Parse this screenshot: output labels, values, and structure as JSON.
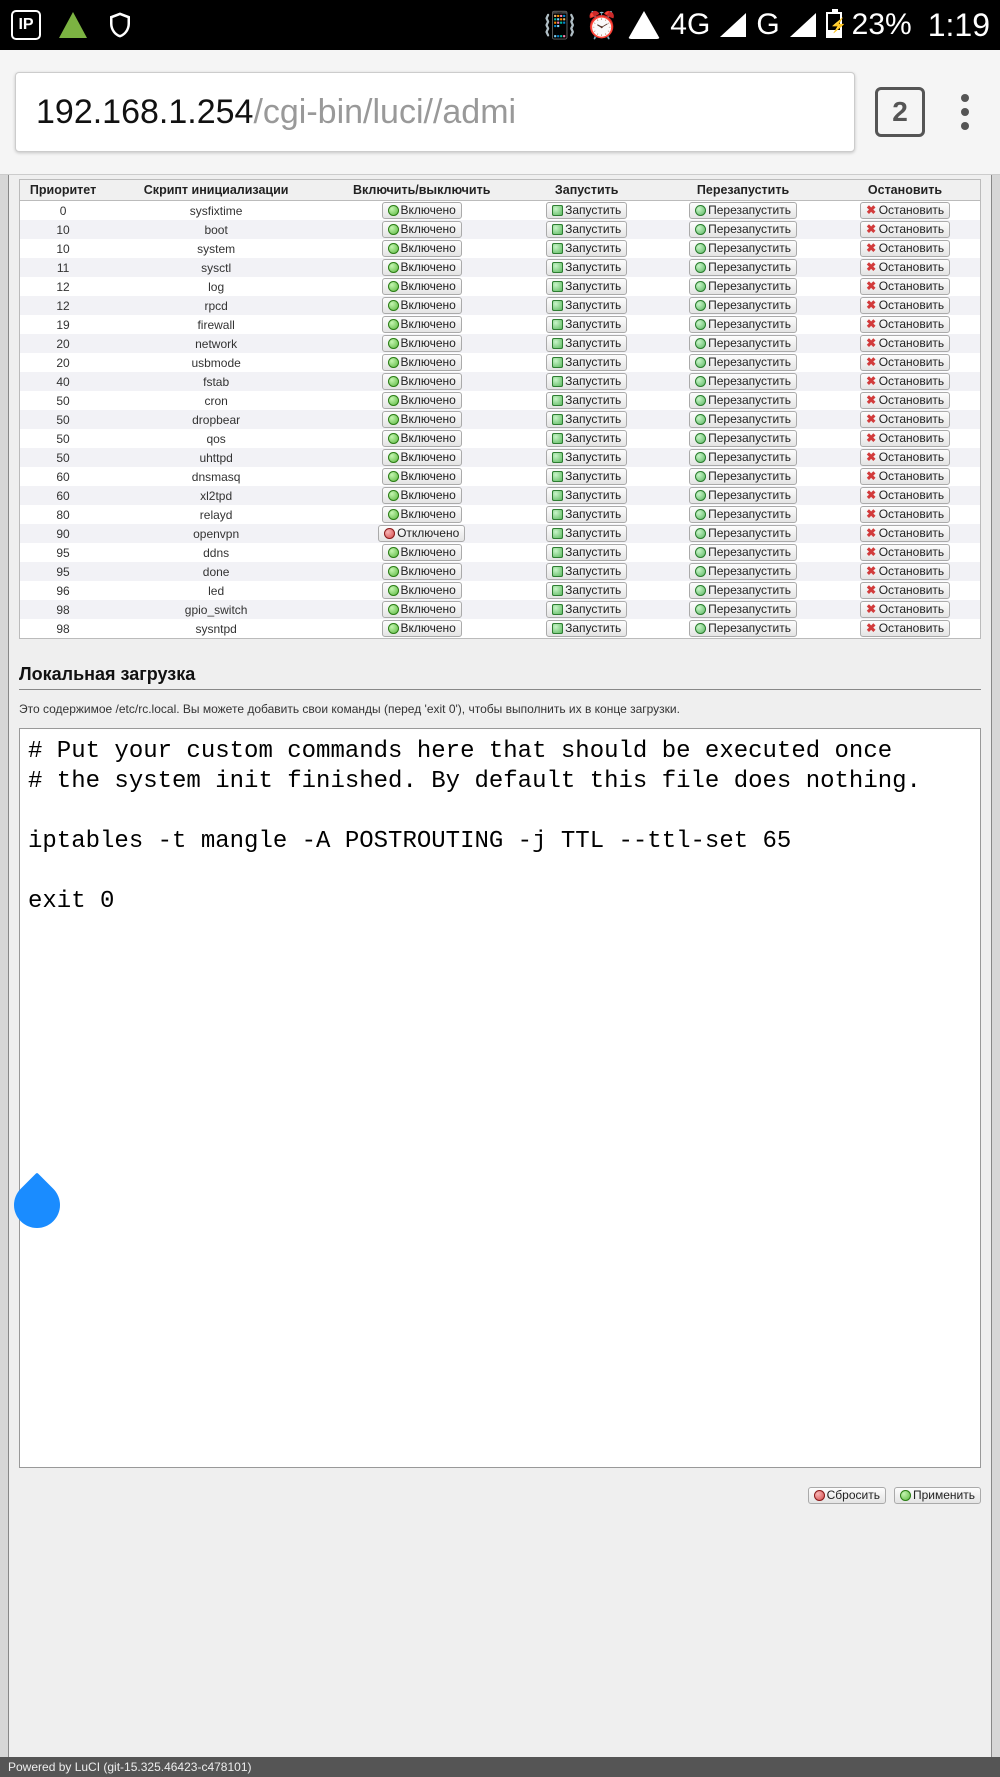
{
  "status_bar": {
    "network_label": "4G",
    "g_label": "G",
    "battery": "23%",
    "time": "1:19",
    "tab_count": "2"
  },
  "address": {
    "host": "192.168.1.254",
    "path": "/cgi-bin/luci//admi"
  },
  "table": {
    "headers": {
      "priority": "Приоритет",
      "script": "Скрипт инициализации",
      "toggle": "Включить/выключить",
      "start": "Запустить",
      "restart": "Перезапустить",
      "stop": "Остановить"
    },
    "labels": {
      "enabled": "Включено",
      "disabled": "Отключено",
      "start": "Запустить",
      "restart": "Перезапустить",
      "stop": "Остановить"
    },
    "rows": [
      {
        "p": "0",
        "name": "sysfixtime",
        "on": true
      },
      {
        "p": "10",
        "name": "boot",
        "on": true
      },
      {
        "p": "10",
        "name": "system",
        "on": true
      },
      {
        "p": "11",
        "name": "sysctl",
        "on": true
      },
      {
        "p": "12",
        "name": "log",
        "on": true
      },
      {
        "p": "12",
        "name": "rpcd",
        "on": true
      },
      {
        "p": "19",
        "name": "firewall",
        "on": true
      },
      {
        "p": "20",
        "name": "network",
        "on": true
      },
      {
        "p": "20",
        "name": "usbmode",
        "on": true
      },
      {
        "p": "40",
        "name": "fstab",
        "on": true
      },
      {
        "p": "50",
        "name": "cron",
        "on": true
      },
      {
        "p": "50",
        "name": "dropbear",
        "on": true
      },
      {
        "p": "50",
        "name": "qos",
        "on": true
      },
      {
        "p": "50",
        "name": "uhttpd",
        "on": true
      },
      {
        "p": "60",
        "name": "dnsmasq",
        "on": true
      },
      {
        "p": "60",
        "name": "xl2tpd",
        "on": true
      },
      {
        "p": "80",
        "name": "relayd",
        "on": true
      },
      {
        "p": "90",
        "name": "openvpn",
        "on": false
      },
      {
        "p": "95",
        "name": "ddns",
        "on": true
      },
      {
        "p": "95",
        "name": "done",
        "on": true
      },
      {
        "p": "96",
        "name": "led",
        "on": true
      },
      {
        "p": "98",
        "name": "gpio_switch",
        "on": true
      },
      {
        "p": "98",
        "name": "sysntpd",
        "on": true
      }
    ]
  },
  "local_startup": {
    "heading": "Локальная загрузка",
    "hint": "Это содержимое /etc/rc.local. Вы можете добавить свои команды (перед 'exit 0'), чтобы выполнить их в конце загрузки.",
    "content": "# Put your custom commands here that should be executed once\n# the system init finished. By default this file does nothing.\n\niptables -t mangle -A POSTROUTING -j TTL --ttl-set 65\n\nexit 0"
  },
  "actions": {
    "reset": "Сбросить",
    "apply": "Применить"
  },
  "footer": "Powered by LuCI (git-15.325.46423-c478101)"
}
